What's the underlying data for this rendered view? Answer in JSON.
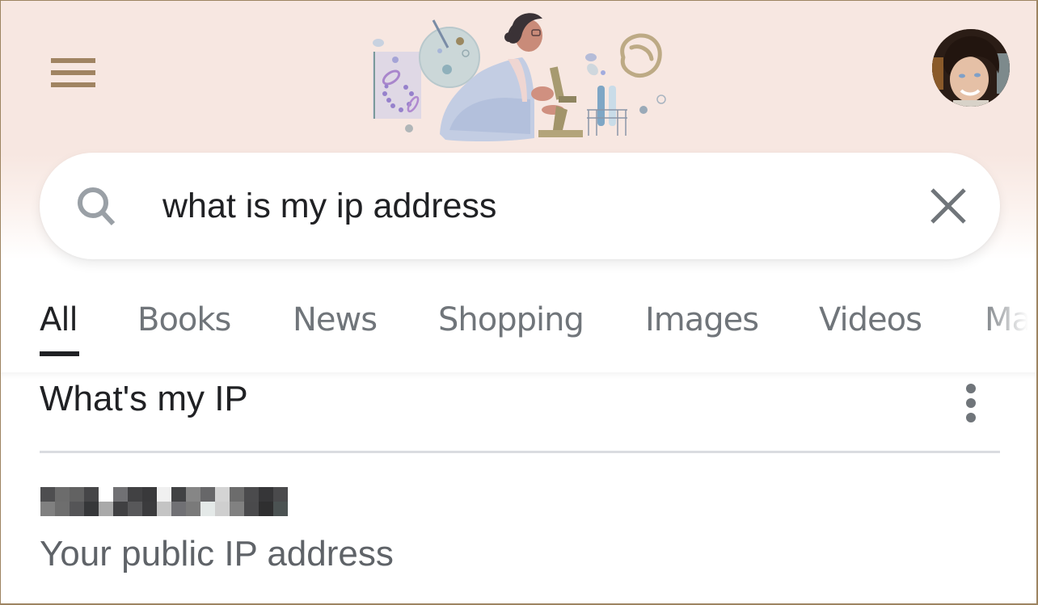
{
  "header": {
    "menu_icon": "hamburger-menu-icon",
    "doodle_alt": "Google Doodle: scientist at microscope",
    "avatar_icon": "user-avatar"
  },
  "search": {
    "value": "what is my ip address",
    "placeholder": "",
    "search_icon": "search-icon",
    "clear_icon": "close-icon"
  },
  "tabs": [
    {
      "label": "All",
      "active": true
    },
    {
      "label": "Books",
      "active": false
    },
    {
      "label": "News",
      "active": false
    },
    {
      "label": "Shopping",
      "active": false
    },
    {
      "label": "Images",
      "active": false
    },
    {
      "label": "Videos",
      "active": false
    },
    {
      "label": "Maps",
      "active": false
    }
  ],
  "result_card": {
    "title": "What's my IP",
    "menu_icon": "more-vert-icon",
    "ip_value_redacted": true,
    "ip_pixel_colors": [
      [
        "#4e4e50",
        "#6c6c6c",
        "#626262",
        "#464648",
        "#ffffff",
        "#717174",
        "#414143",
        "#39393b",
        "#f0f0f0",
        "#414244",
        "#868686",
        "#676769",
        "#d4d4d4",
        "#6c6c6c",
        "#4b4b4d",
        "#363638",
        "#4a4a4c"
      ],
      [
        "#808080",
        "#6e6e6e",
        "#555557",
        "#363739",
        "#a9a9a9",
        "#404042",
        "#58585a",
        "#3b3b3d",
        "#c4c4c4",
        "#707074",
        "#7a7a7a",
        "#e4e9e8",
        "#cfcfcf",
        "#818181",
        "#4a4a4c",
        "#2f2f30",
        "#4b5252"
      ]
    ],
    "subtitle": "Your public IP address"
  },
  "colors": {
    "header_bg": "#f7e7e1",
    "hamburger": "#a08462",
    "active_tab": "#202124",
    "inactive_tab": "#70757a",
    "icon_gray": "#9aa0a6",
    "divider": "#dadce0"
  }
}
